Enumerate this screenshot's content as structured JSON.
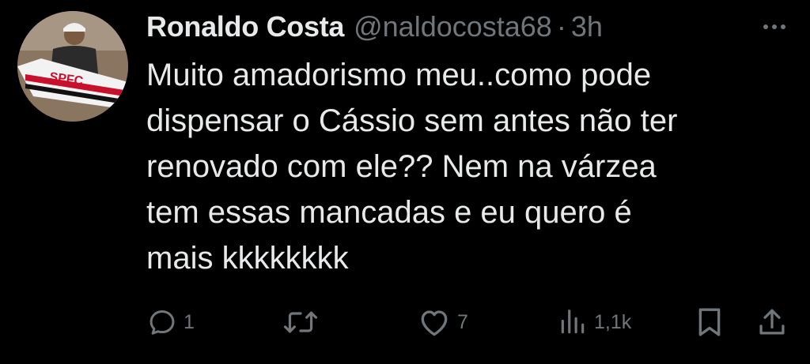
{
  "author": {
    "name": "Ronaldo Costa",
    "handle": "@naldocosta68",
    "separator": "·",
    "time": "3h"
  },
  "tweet": {
    "lines": [
      "Muito amadorismo meu..como pode",
      "dispensar o Cássio sem antes não ter",
      "renovado com ele?? Nem na várzea",
      "tem essas mancadas e eu quero é",
      "mais kkkkkkkk"
    ]
  },
  "actions": {
    "reply": {
      "icon": "reply-icon",
      "count": "1"
    },
    "retweet": {
      "icon": "retweet-icon",
      "count": ""
    },
    "like": {
      "icon": "heart-icon",
      "count": "7"
    },
    "views": {
      "icon": "views-icon",
      "count": "1,1k"
    },
    "bookmark": {
      "icon": "bookmark-icon"
    },
    "share": {
      "icon": "share-icon"
    }
  },
  "colors": {
    "background": "#000000",
    "text": "#e7e9ea",
    "secondary": "#71767b"
  }
}
